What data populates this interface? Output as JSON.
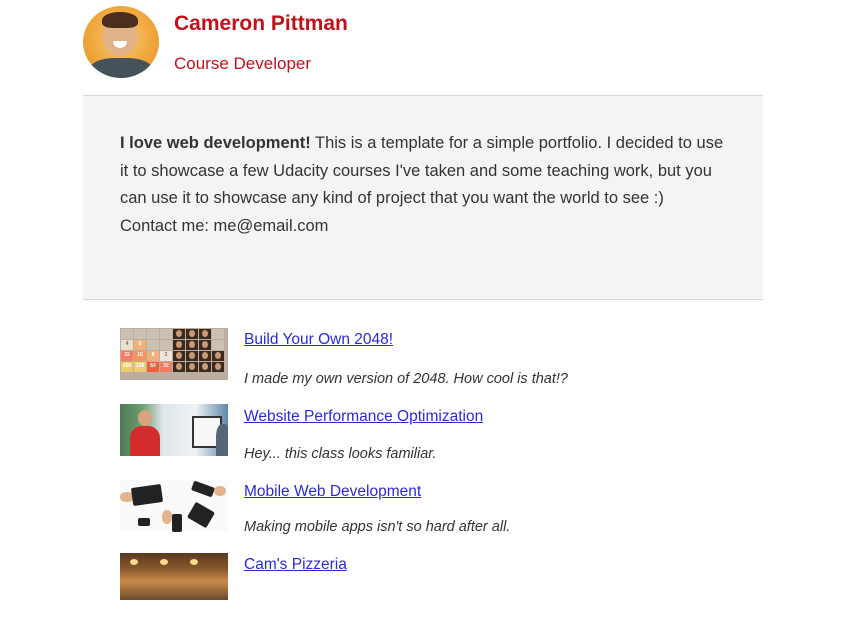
{
  "profile": {
    "name": "Cameron Pittman",
    "role": "Course Developer"
  },
  "intro": {
    "lead": "I love web development!",
    "body": " This is a template for a simple portfolio. I decided to use it to showcase a few Udacity courses I've taken and some teaching work, but you can use it to showcase any kind of project that you want the world to see :)",
    "contact": "Contact me: me@email.com"
  },
  "projects": [
    {
      "title": "Build Your Own 2048!",
      "description": "I made my own version of 2048. How cool is that!?"
    },
    {
      "title": "Website Performance Optimization",
      "description": "Hey... this class looks familiar."
    },
    {
      "title": "Mobile Web Development",
      "description": "Making mobile apps isn't so hard after all."
    },
    {
      "title": "Cam's Pizzeria",
      "description": ""
    }
  ],
  "game_tiles": [
    "4",
    "8",
    "32",
    "16",
    "8",
    "2",
    "256",
    "128",
    "64",
    "32"
  ],
  "colors": {
    "name": "#c1111a",
    "link": "#2a2adb",
    "intro_bg": "#f4f4f4"
  }
}
